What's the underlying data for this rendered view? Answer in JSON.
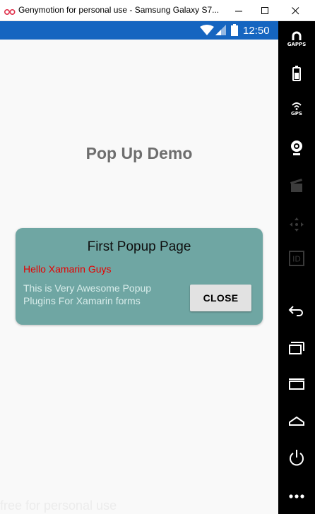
{
  "window": {
    "title": "Genymotion for personal use - Samsung Galaxy S7...",
    "icons": [
      "genymotion-logo-icon",
      "minimize-icon",
      "maximize-icon",
      "close-icon"
    ]
  },
  "statusbar": {
    "time": "12:50",
    "icons": [
      "wifi-icon",
      "signal-icon",
      "battery-icon"
    ],
    "color": "#1565c0"
  },
  "page": {
    "title": "Pop Up Demo"
  },
  "popup": {
    "title": "First Popup Page",
    "greeting": "Hello Xamarin Guys",
    "description": "This is Very Awesome Popup Plugins For Xamarin forms",
    "close_label": "CLOSE",
    "background": "#6fa6a3",
    "greeting_color": "#e60000"
  },
  "watermark": "free for personal use",
  "toolbar": {
    "gapps_label": "GAPPS",
    "gps_label": "GPS",
    "id_label": "ID",
    "items": [
      "gapps-icon",
      "battery-icon",
      "gps-icon",
      "webcam-icon",
      "media-icon",
      "dpad-icon",
      "id-icon",
      "back-icon",
      "recent-apps-icon",
      "menu-icon",
      "home-icon",
      "power-icon",
      "more-icon"
    ]
  }
}
